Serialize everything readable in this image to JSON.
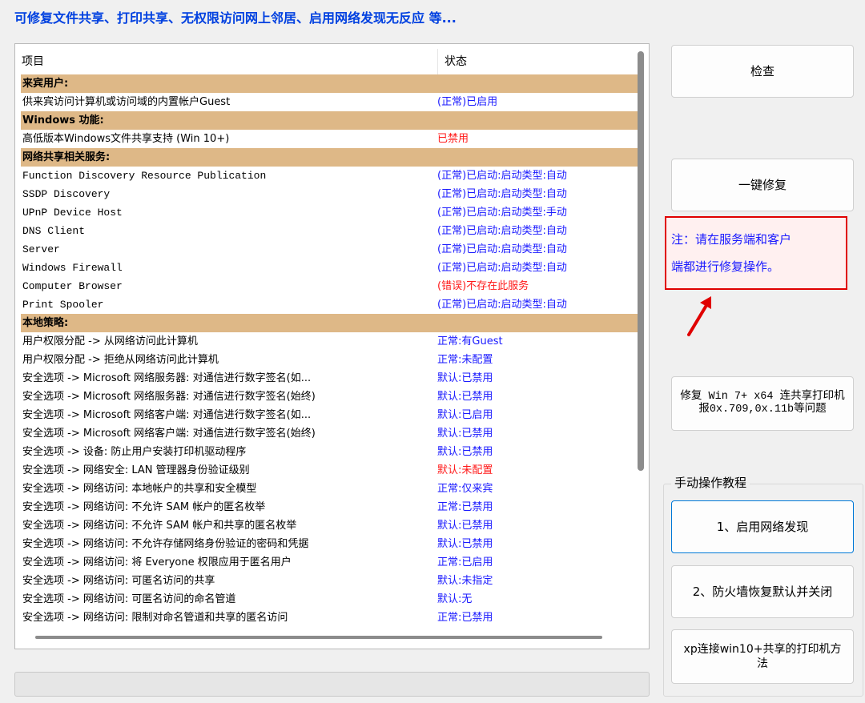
{
  "header": {
    "title": "可修复文件共享、打印共享、无权限访问网上邻居、启用网络发现无反应  等..."
  },
  "list": {
    "col_item": "项目",
    "col_status": "状态",
    "rows": [
      {
        "type": "cat",
        "item": "来宾用户:",
        "status": ""
      },
      {
        "type": "row",
        "item": "供来宾访问计算机或访问域的内置帐户Guest",
        "status": "(正常)已启用",
        "color": "blue"
      },
      {
        "type": "cat",
        "item": "Windows 功能:",
        "status": ""
      },
      {
        "type": "row",
        "item": "高低版本Windows文件共享支持 (Win 10+)",
        "status": "已禁用",
        "color": "red"
      },
      {
        "type": "cat",
        "item": "网络共享相关服务:",
        "status": ""
      },
      {
        "type": "row",
        "item": "Function Discovery Resource Publication",
        "status": "(正常)已启动:启动类型:自动",
        "color": "blue",
        "mono": true
      },
      {
        "type": "row",
        "item": "SSDP Discovery",
        "status": "(正常)已启动:启动类型:自动",
        "color": "blue",
        "mono": true
      },
      {
        "type": "row",
        "item": "UPnP Device Host",
        "status": "(正常)已启动:启动类型:手动",
        "color": "blue",
        "mono": true
      },
      {
        "type": "row",
        "item": "DNS Client",
        "status": "(正常)已启动:启动类型:自动",
        "color": "blue",
        "mono": true
      },
      {
        "type": "row",
        "item": "Server",
        "status": "(正常)已启动:启动类型:自动",
        "color": "blue",
        "mono": true
      },
      {
        "type": "row",
        "item": "Windows Firewall",
        "status": "(正常)已启动:启动类型:自动",
        "color": "blue",
        "mono": true
      },
      {
        "type": "row",
        "item": "Computer Browser",
        "status": "(错误)不存在此服务",
        "color": "red",
        "mono": true
      },
      {
        "type": "row",
        "item": "Print Spooler",
        "status": "(正常)已启动:启动类型:自动",
        "color": "blue",
        "mono": true
      },
      {
        "type": "cat",
        "item": "本地策略:",
        "status": ""
      },
      {
        "type": "row",
        "item": "用户权限分配 -> 从网络访问此计算机",
        "status": "正常:有Guest",
        "color": "blue"
      },
      {
        "type": "row",
        "item": "用户权限分配 -> 拒绝从网络访问此计算机",
        "status": "正常:未配置",
        "color": "blue"
      },
      {
        "type": "row",
        "item": "安全选项 -> Microsoft 网络服务器: 对通信进行数字签名(如...",
        "status": "默认:已禁用",
        "color": "blue"
      },
      {
        "type": "row",
        "item": "安全选项 -> Microsoft 网络服务器: 对通信进行数字签名(始终)",
        "status": "默认:已禁用",
        "color": "blue"
      },
      {
        "type": "row",
        "item": "安全选项 -> Microsoft 网络客户端: 对通信进行数字签名(如...",
        "status": "默认:已启用",
        "color": "blue"
      },
      {
        "type": "row",
        "item": "安全选项 -> Microsoft 网络客户端: 对通信进行数字签名(始终)",
        "status": "默认:已禁用",
        "color": "blue"
      },
      {
        "type": "row",
        "item": "安全选项 -> 设备: 防止用户安装打印机驱动程序",
        "status": "默认:已禁用",
        "color": "blue"
      },
      {
        "type": "row",
        "item": "安全选项 -> 网络安全: LAN 管理器身份验证级别",
        "status": "默认:未配置",
        "color": "red"
      },
      {
        "type": "row",
        "item": "安全选项 -> 网络访问: 本地帐户的共享和安全模型",
        "status": "正常:仅来宾",
        "color": "blue"
      },
      {
        "type": "row",
        "item": "安全选项 -> 网络访问: 不允许 SAM 帐户的匿名枚举",
        "status": "正常:已禁用",
        "color": "blue"
      },
      {
        "type": "row",
        "item": "安全选项 -> 网络访问: 不允许 SAM 帐户和共享的匿名枚举",
        "status": "默认:已禁用",
        "color": "blue"
      },
      {
        "type": "row",
        "item": "安全选项 -> 网络访问: 不允许存储网络身份验证的密码和凭据",
        "status": "默认:已禁用",
        "color": "blue"
      },
      {
        "type": "row",
        "item": "安全选项 -> 网络访问: 将 Everyone 权限应用于匿名用户",
        "status": "正常:已启用",
        "color": "blue"
      },
      {
        "type": "row",
        "item": "安全选项 -> 网络访问: 可匿名访问的共享",
        "status": "默认:未指定",
        "color": "blue"
      },
      {
        "type": "row",
        "item": "安全选项 -> 网络访问: 可匿名访问的命名管道",
        "status": "默认:无",
        "color": "blue"
      },
      {
        "type": "row",
        "item": "安全选项 -> 网络访问: 限制对命名管道和共享的匿名访问",
        "status": "正常:已禁用",
        "color": "blue"
      }
    ]
  },
  "buttons": {
    "check": "检查",
    "one_click_fix": "一键修复",
    "fix_printer": "修复 Win 7+ x64 连共享打印机报0x.709,0x.11b等问题",
    "enable_discovery": "1、启用网络发现",
    "firewall_reset": "2、防火墙恢复默认并关闭",
    "xp_connect": "xp连接win10+共享的打印机方法"
  },
  "note": {
    "line1": "注：请在服务端和客户",
    "line2": "端都进行修复操作。"
  },
  "group": {
    "title": "手动操作教程"
  },
  "colors": {
    "title_blue": "#0040e0",
    "category_bg": "#deb887",
    "ok_blue": "#1a1aff",
    "error_red": "#ff1a1a",
    "note_border": "#e00000"
  }
}
